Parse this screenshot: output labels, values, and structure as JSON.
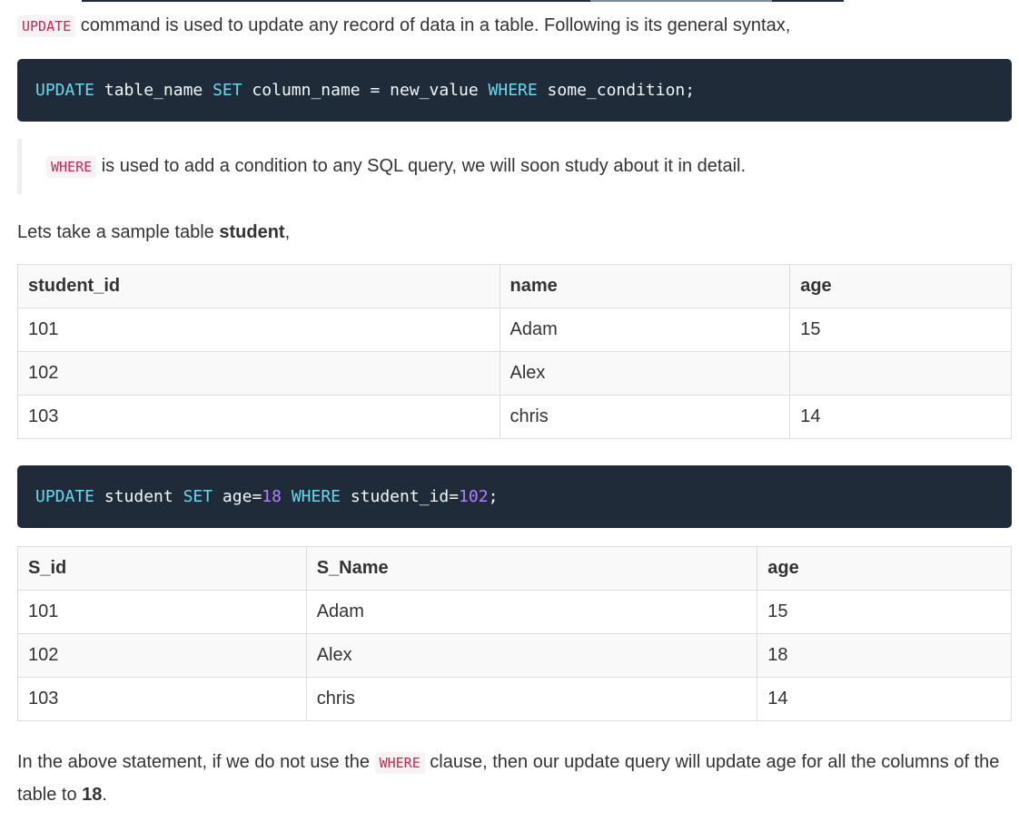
{
  "intro": {
    "code": "UPDATE",
    "text": " command is used to update any record of data in a table. Following is its general syntax,"
  },
  "syntax_block": {
    "k1": "UPDATE",
    "t1": " table_name ",
    "k2": "SET",
    "t2": " column_name = new_value ",
    "k3": "WHERE",
    "t3": " some_condition;"
  },
  "note": {
    "code": "WHERE",
    "text": " is used to add a condition to any SQL query, we will soon study about it in detail."
  },
  "sample": {
    "text": "Lets take a sample table ",
    "bold": "student",
    "tail": ","
  },
  "table1": {
    "headers": [
      "student_id",
      "name",
      "age"
    ],
    "rows": [
      [
        "101",
        "Adam",
        "15"
      ],
      [
        "102",
        "Alex",
        ""
      ],
      [
        "103",
        "chris",
        "14"
      ]
    ]
  },
  "query_block": {
    "k1": "UPDATE",
    "t1": " student ",
    "k2": "SET",
    "t2": " age=",
    "n1": "18",
    "t3": " ",
    "k3": "WHERE",
    "t4": " student_id=",
    "n2": "102",
    "t5": ";"
  },
  "table2": {
    "headers": [
      "S_id",
      "S_Name",
      "age"
    ],
    "rows": [
      [
        "101",
        "Adam",
        "15"
      ],
      [
        "102",
        "Alex",
        "18"
      ],
      [
        "103",
        "chris",
        "14"
      ]
    ]
  },
  "outro": {
    "t1": "In the above statement, if we do not use the ",
    "code": "WHERE",
    "t2": " clause, then our update query will update age for all the columns of the table to ",
    "bold": "18",
    "t3": "."
  }
}
